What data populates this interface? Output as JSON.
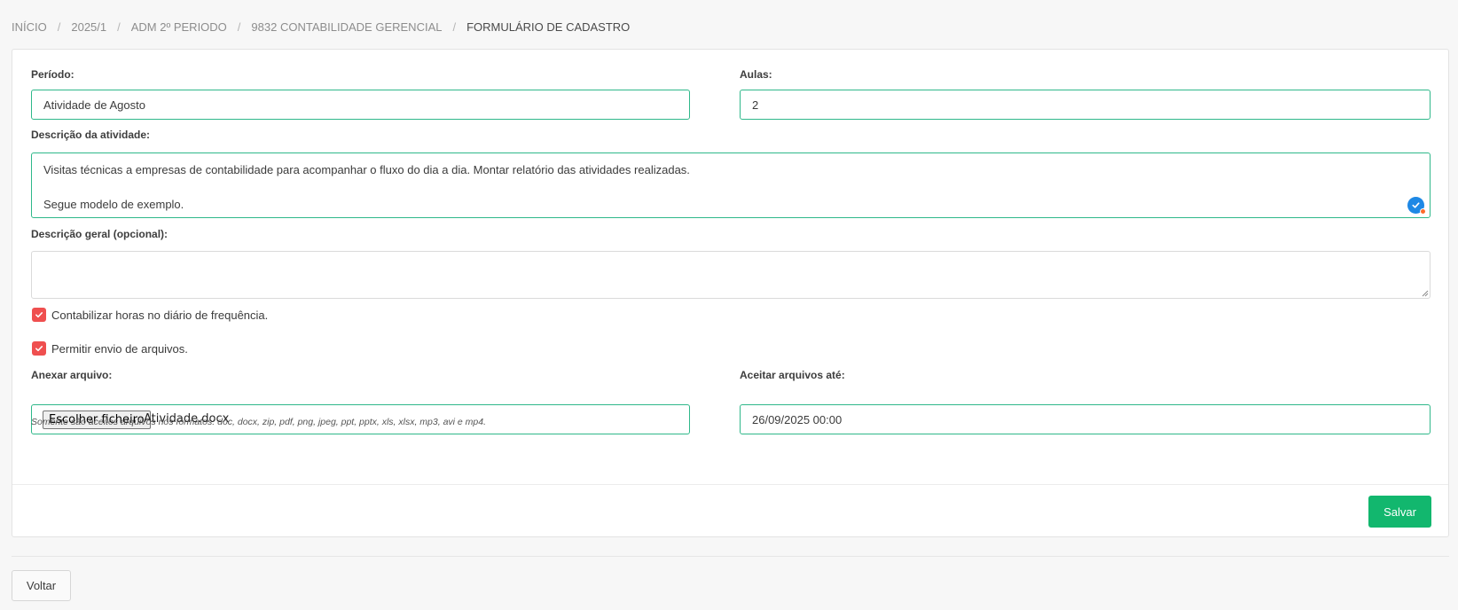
{
  "breadcrumb": {
    "items": [
      {
        "label": "INÍCIO"
      },
      {
        "label": "2025/1"
      },
      {
        "label": "ADM 2º PERIODO"
      },
      {
        "label": "9832 CONTABILIDADE GERENCIAL"
      },
      {
        "label": "FORMULÁRIO DE CADASTRO"
      }
    ],
    "separator": "/"
  },
  "form": {
    "periodo": {
      "label": "Período:",
      "value": "Atividade de Agosto"
    },
    "aulas": {
      "label": "Aulas:",
      "value": "2"
    },
    "descricao_atividade": {
      "label": "Descrição da atividade:",
      "lines": [
        "Visitas técnicas a empresas de contabilidade para acompanhar o fluxo do dia a dia. Montar relatório das atividades realizadas.",
        "",
        "Segue modelo de exemplo."
      ]
    },
    "descricao_geral": {
      "label": "Descrição geral (opcional):",
      "value": ""
    },
    "contabilizar_horas": {
      "label": "Contabilizar horas no diário de frequência.",
      "checked": true
    },
    "permitir_envio": {
      "label": "Permitir envio de arquivos.",
      "checked": true
    },
    "anexar_arquivo": {
      "label": "Anexar arquivo:",
      "button_label": "Escolher ficheiro",
      "file_name": "Atividade.docx",
      "help": "Somente são aceitos arquivos nos formatos: doc, docx, zip, pdf, png, jpeg, ppt, pptx, xls, xlsx, mp3, avi e mp4."
    },
    "aceitar_ate": {
      "label": "Aceitar arquivos até:",
      "value": "26/09/2025 00:00"
    }
  },
  "actions": {
    "save_label": "Salvar",
    "back_label": "Voltar"
  },
  "colors": {
    "accent_border": "#2fb88a",
    "save_button": "#12b76e",
    "checkbox": "#ef4f4f",
    "grammar_badge": "#1e88e5"
  },
  "icons": {
    "checkbox": "check-icon",
    "grammar": "grammar-check-icon"
  }
}
